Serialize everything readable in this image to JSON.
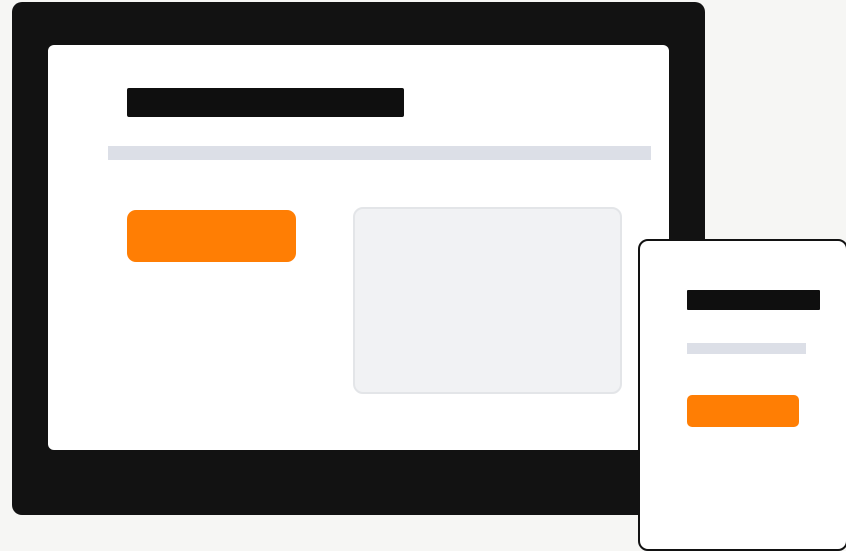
{
  "colors": {
    "frame": "#121212",
    "ink": "#0f0f0f",
    "rule": "#dcdfe7",
    "accent": "#ff7e04"
  },
  "desktop": {
    "title_placeholder": "",
    "primary_button_label": ""
  },
  "mobile": {
    "title_placeholder": "",
    "primary_button_label": ""
  }
}
